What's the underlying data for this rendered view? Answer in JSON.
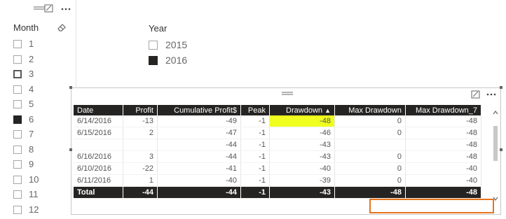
{
  "month_slicer": {
    "title": "Month",
    "icons": {
      "eraser": "eraser-icon",
      "focus": "focus-mode-icon",
      "more": "more-options-icon"
    },
    "items": [
      {
        "label": "1",
        "state": "unchecked"
      },
      {
        "label": "2",
        "state": "unchecked"
      },
      {
        "label": "3",
        "state": "hover"
      },
      {
        "label": "4",
        "state": "unchecked"
      },
      {
        "label": "5",
        "state": "unchecked"
      },
      {
        "label": "6",
        "state": "checked"
      },
      {
        "label": "7",
        "state": "unchecked"
      },
      {
        "label": "8",
        "state": "unchecked"
      },
      {
        "label": "9",
        "state": "unchecked"
      },
      {
        "label": "10",
        "state": "unchecked"
      },
      {
        "label": "11",
        "state": "unchecked"
      },
      {
        "label": "12",
        "state": "unchecked"
      }
    ]
  },
  "year_slicer": {
    "title": "Year",
    "items": [
      {
        "label": "2015",
        "state": "unchecked"
      },
      {
        "label": "2016",
        "state": "checked"
      }
    ]
  },
  "table": {
    "columns": [
      "Date",
      "Profit",
      "Cumulative Profit$",
      "Peak",
      "Drawdown",
      "Max Drawdown",
      "Max Drawdown_7"
    ],
    "sort_column": "Drawdown",
    "sort_direction": "ascending",
    "rows": [
      [
        "6/14/2016",
        "-13",
        "-49",
        "-1",
        "-48",
        "0",
        "-48"
      ],
      [
        "6/15/2016",
        "2",
        "-47",
        "-1",
        "-46",
        "0",
        "-48"
      ],
      [
        "",
        "",
        "-44",
        "-1",
        "-43",
        "",
        "-48"
      ],
      [
        "6/16/2016",
        "3",
        "-44",
        "-1",
        "-43",
        "0",
        "-48"
      ],
      [
        "6/10/2016",
        "-22",
        "-41",
        "-1",
        "-40",
        "0",
        "-40"
      ],
      [
        "6/11/2016",
        "1",
        "-40",
        "-1",
        "-39",
        "0",
        "-40"
      ]
    ],
    "highlight_cell": {
      "row": 0,
      "col": 4,
      "color": "#f0ff1f"
    },
    "total": [
      "Total",
      "-44",
      "-44",
      "-1",
      "-43",
      "-48",
      "-48"
    ]
  },
  "colors": {
    "header_bg": "#252423",
    "highlight": "#f0ff1f",
    "callout": "#e8741c"
  }
}
